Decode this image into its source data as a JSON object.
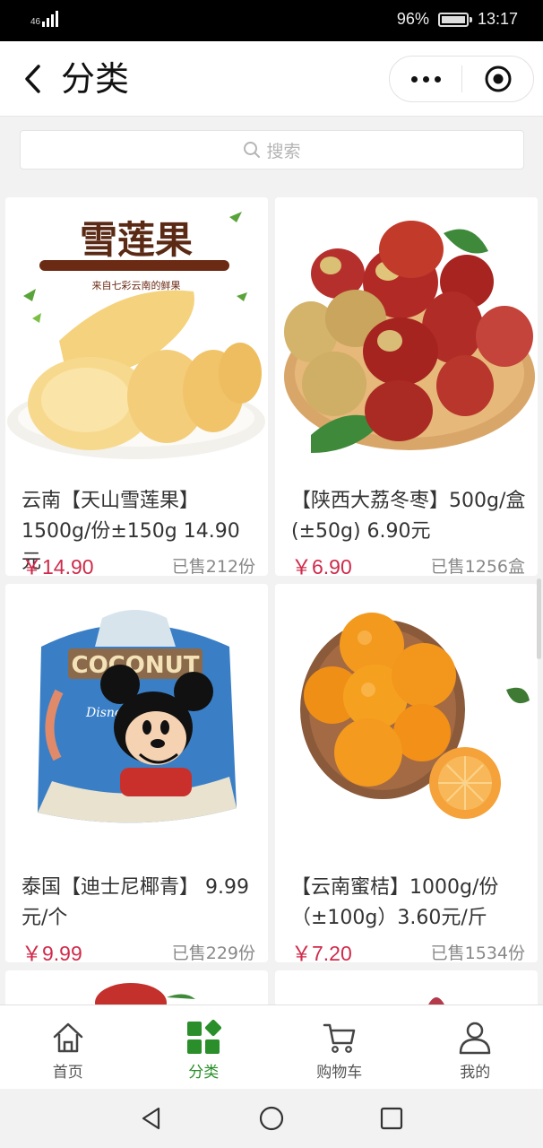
{
  "status_bar": {
    "network": "46",
    "battery": "96%",
    "time": "13:17",
    "battery_level": 0.96
  },
  "nav": {
    "title": "分类",
    "icons": [
      "back-chevron-icon",
      "more-dots-icon",
      "close-target-icon"
    ]
  },
  "search": {
    "placeholder": "搜索",
    "icon": "search-icon"
  },
  "products": [
    {
      "title": "云南【天山雪莲果】1500g/份±150g 14.90元",
      "price": "￥14.90",
      "sold": "已售212份",
      "image": "snow-lotus-fruit-image"
    },
    {
      "title": "【陕西大荔冬枣】500g/盒(±50g) 6.90元",
      "price": "￥6.90",
      "sold": "已售1256盒",
      "image": "winter-jujube-image"
    },
    {
      "title": "泰国【迪士尼椰青】 9.99元/个",
      "price": "￥9.99",
      "sold": "已售229份",
      "image": "disney-coconut-image"
    },
    {
      "title": "【云南蜜桔】1000g/份（±100g）3.60元/斤",
      "price": "￥7.20",
      "sold": "已售1534份",
      "image": "mandarin-orange-image"
    }
  ],
  "tabs": [
    {
      "label": "首页",
      "icon": "home-icon",
      "active": false
    },
    {
      "label": "分类",
      "icon": "category-grid-icon",
      "active": true
    },
    {
      "label": "购物车",
      "icon": "cart-icon",
      "active": false
    },
    {
      "label": "我的",
      "icon": "user-icon",
      "active": false
    }
  ],
  "colors": {
    "price": "#d02a4a",
    "active_tab": "#2a8f2a",
    "background": "#f2f2f2"
  }
}
